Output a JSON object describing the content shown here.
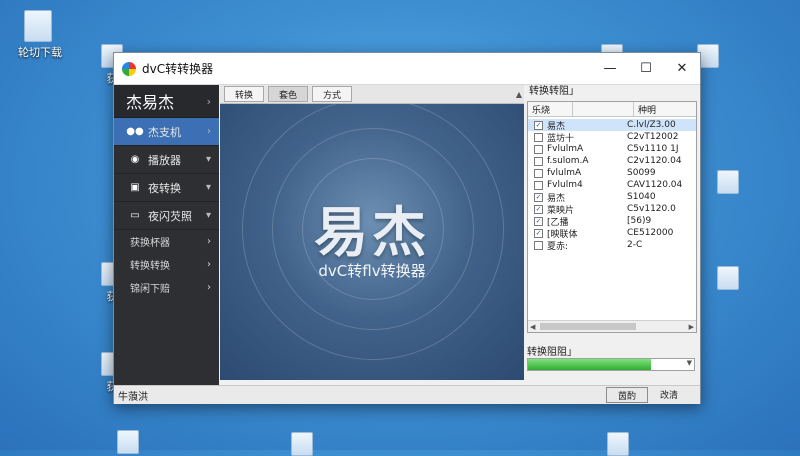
{
  "desktop": {
    "icon_label": "轮切下载",
    "side_labels": [
      "获",
      "获",
      "获"
    ]
  },
  "window": {
    "title": "dvC转转换器",
    "controls": {
      "minimize": "—",
      "maximize": "☐",
      "close": "✕"
    }
  },
  "sidebar": {
    "brand": "杰易杰",
    "items": [
      {
        "label": "杰支机",
        "icon": "users-icon",
        "active": true
      },
      {
        "label": "播放器",
        "icon": "eye-icon",
        "active": false
      },
      {
        "label": "夜转换",
        "icon": "film-icon",
        "active": false
      },
      {
        "label": "夜闪芡照",
        "icon": "monitor-icon",
        "active": false
      }
    ],
    "subitems": [
      {
        "label": "获换杯器"
      },
      {
        "label": "转换转换"
      },
      {
        "label": "锦闲下赔"
      }
    ]
  },
  "tabs": [
    "转换",
    "套色",
    "方式"
  ],
  "preview": {
    "logo": "易杰",
    "subtitle": "dvC转flv转换器"
  },
  "right_panel": {
    "title": "转换转阻」",
    "columns": [
      "乐烧",
      "",
      "种明"
    ],
    "rows": [
      {
        "checked": true,
        "name": "易杰",
        "value": "C.lvl/Z3.00",
        "selected": true
      },
      {
        "checked": false,
        "name": "蓝坊十",
        "value": "C2vT12002",
        "selected": false
      },
      {
        "checked": false,
        "name": "FvlulmA",
        "value": "C5v1110 1J",
        "selected": false
      },
      {
        "checked": false,
        "name": "f.sulom.A",
        "value": "C2v1120.04",
        "selected": false
      },
      {
        "checked": false,
        "name": "fvlulmA",
        "value": "S0099",
        "selected": false
      },
      {
        "checked": false,
        "name": "Fvlulm4",
        "value": "CAV1120.04",
        "selected": false
      },
      {
        "checked": true,
        "name": "易杰",
        "value": "S1040",
        "selected": false
      },
      {
        "checked": true,
        "name": "菜映片",
        "value": "C5v1120.0",
        "selected": false
      },
      {
        "checked": true,
        "name": "[乙播",
        "value": "[56)9",
        "selected": false
      },
      {
        "checked": true,
        "name": "[映联体",
        "value": "CE512000",
        "selected": false
      },
      {
        "checked": false,
        "name": "夏赤:",
        "value": "2-C",
        "selected": false
      }
    ],
    "progress_title": "转换阻阻」",
    "progress": 0.74
  },
  "statusbar": {
    "text": "牛蒗洪",
    "open_button": "茵酌",
    "close_button": "改清"
  },
  "colors": {
    "sidebar_bg": "#2d2f33",
    "active_nav": "#3c6fb4",
    "progress_fill": "#2fae2f"
  }
}
